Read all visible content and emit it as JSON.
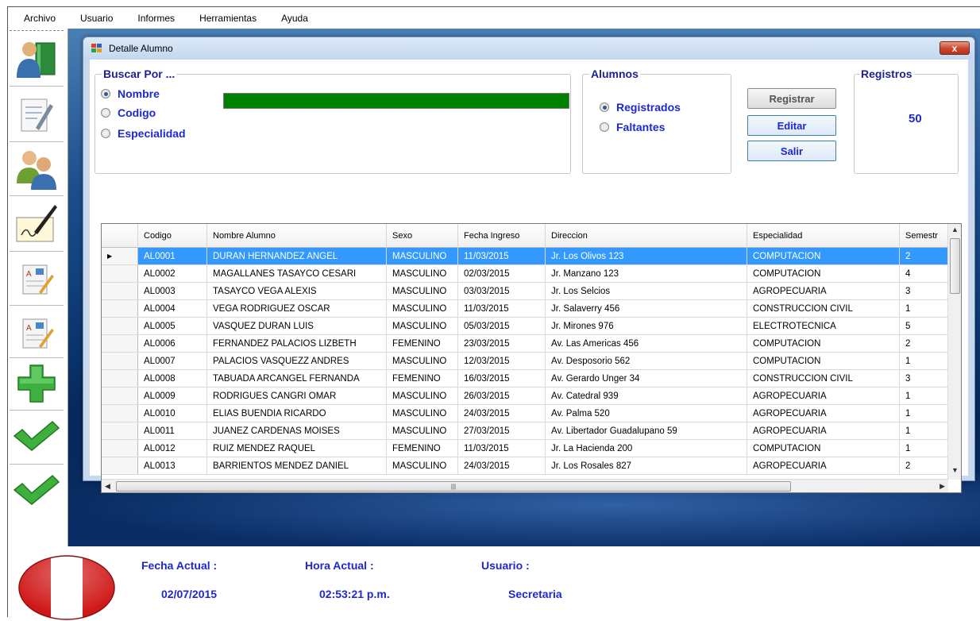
{
  "menu": [
    "Archivo",
    "Usuario",
    "Informes",
    "Herramientas",
    "Ayuda"
  ],
  "window": {
    "title": "Detalle Alumno",
    "close_label": "x"
  },
  "search": {
    "group_title": "Buscar Por ...",
    "options": [
      "Nombre",
      "Codigo",
      "Especialidad"
    ],
    "selected": "Nombre",
    "value": ""
  },
  "alumnos": {
    "group_title": "Alumnos",
    "options": [
      "Registrados",
      "Faltantes"
    ],
    "selected": "Registrados"
  },
  "buttons": {
    "registrar": "Registrar",
    "editar": "Editar",
    "salir": "Salir"
  },
  "registros": {
    "title": "Registros",
    "count": "50"
  },
  "grid": {
    "columns": [
      "Codigo",
      "Nombre Alumno",
      "Sexo",
      "Fecha Ingreso",
      "Direccion",
      "Especialidad",
      "Semestr"
    ],
    "rows": [
      [
        "AL0001",
        "DURAN  HERNANDEZ ANGEL",
        "MASCULINO",
        "11/03/2015",
        "Jr. Los Olivos 123",
        "COMPUTACION",
        "2"
      ],
      [
        "AL0002",
        "MAGALLANES  TASAYCO CESARI",
        "MASCULINO",
        "02/03/2015",
        "Jr. Manzano 123",
        "COMPUTACION",
        "4"
      ],
      [
        "AL0003",
        "TASAYCO  VEGA ALEXIS",
        "MASCULINO",
        "03/03/2015",
        "Jr. Los Selcios",
        "AGROPECUARIA",
        "3"
      ],
      [
        "AL0004",
        "VEGA  RODRIGUEZ OSCAR",
        "MASCULINO",
        "11/03/2015",
        "Jr. Salaverry 456",
        "CONSTRUCCION CIVIL",
        "1"
      ],
      [
        "AL0005",
        "VASQUEZ  DURAN LUIS",
        "MASCULINO",
        "05/03/2015",
        "Jr. Mirones 976",
        "ELECTROTECNICA",
        "5"
      ],
      [
        "AL0006",
        "FERNANDEZ  PALACIOS LIZBETH",
        "FEMENINO",
        "23/03/2015",
        "Av. Las Americas 456",
        "COMPUTACION",
        "2"
      ],
      [
        "AL0007",
        "PALACIOS  VASQUEZZ ANDRES",
        "MASCULINO",
        "12/03/2015",
        "Av. Desposorio 562",
        "COMPUTACION",
        "1"
      ],
      [
        "AL0008",
        "TABUADA  ARCANGEL FERNANDA",
        "FEMENINO",
        "16/03/2015",
        "Av. Gerardo Unger 34",
        "CONSTRUCCION CIVIL",
        "3"
      ],
      [
        "AL0009",
        "RODRIGUES  CANGRI OMAR",
        "MASCULINO",
        "26/03/2015",
        "Av. Catedral 939",
        "AGROPECUARIA",
        "1"
      ],
      [
        "AL0010",
        "ELIAS  BUENDIA RICARDO",
        "MASCULINO",
        "24/03/2015",
        "Av. Palma 520",
        "AGROPECUARIA",
        "1"
      ],
      [
        "AL0011",
        "JUANEZ  CARDENAS MOISES",
        "MASCULINO",
        "27/03/2015",
        "Av. Libertador Guadalupano 59",
        "AGROPECUARIA",
        "1"
      ],
      [
        "AL0012",
        "RUIZ  MENDEZ RAQUEL",
        "FEMENINO",
        "11/03/2015",
        "Jr. La Hacienda 200",
        "COMPUTACION",
        "1"
      ],
      [
        "AL0013",
        "BARRIENTOS  MENDEZ DANIEL",
        "MASCULINO",
        "24/03/2015",
        "Jr. Los Rosales 827",
        "AGROPECUARIA",
        "2"
      ]
    ],
    "selected_row": 0
  },
  "status": {
    "fecha_label": "Fecha Actual :",
    "hora_label": "Hora Actual :",
    "usuario_label": "Usuario :",
    "fecha_value": "02/07/2015",
    "hora_value": "02:53:21 p.m.",
    "usuario_value": "Secretaria"
  },
  "colors": {
    "accent_text": "#1e28d2",
    "search_fill": "#008000",
    "selection": "#3399ff"
  },
  "toolbar_icons": [
    "students-book-icon",
    "edit-document-icon",
    "users-icon",
    "signature-icon",
    "report-icon",
    "report-icon",
    "add-icon",
    "check-icon",
    "check-icon"
  ]
}
